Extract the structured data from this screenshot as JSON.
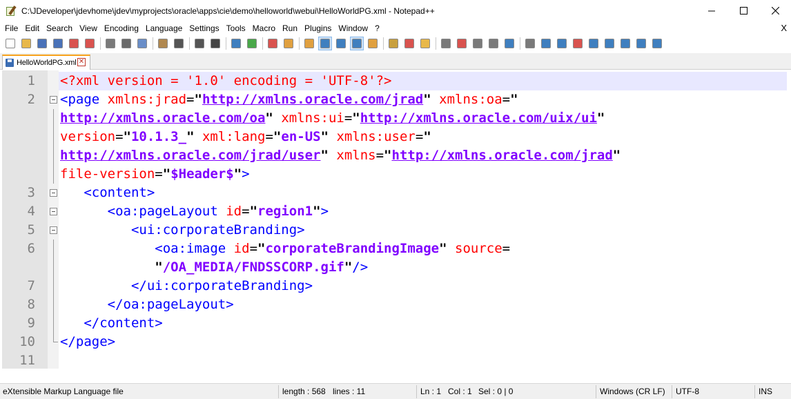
{
  "window": {
    "title": "C:\\JDeveloper\\jdevhome\\jdev\\myprojects\\oracle\\apps\\cie\\demo\\helloworld\\webui\\HelloWorldPG.xml - Notepad++",
    "minimize_icon": "minimize-icon",
    "maximize_icon": "maximize-icon",
    "close_icon": "close-icon"
  },
  "menu": {
    "items": [
      "File",
      "Edit",
      "Search",
      "View",
      "Encoding",
      "Language",
      "Settings",
      "Tools",
      "Macro",
      "Run",
      "Plugins",
      "Window",
      "?"
    ],
    "close": "X"
  },
  "toolbar": {
    "icons": [
      {
        "name": "new-file-icon",
        "color": "#ffffff"
      },
      {
        "name": "open-file-icon",
        "color": "#e8b84a"
      },
      {
        "name": "save-icon",
        "color": "#4a72b8"
      },
      {
        "name": "save-all-icon",
        "color": "#4a72b8"
      },
      {
        "name": "close-file-icon",
        "color": "#d9534f"
      },
      {
        "name": "close-all-icon",
        "color": "#d9534f"
      },
      {
        "name": "print-icon",
        "color": "#7a7a7a"
      },
      {
        "name": "cut-icon",
        "color": "#6a6a6a"
      },
      {
        "name": "copy-icon",
        "color": "#6a8ec8"
      },
      {
        "name": "paste-icon",
        "color": "#b08850"
      },
      {
        "name": "undo-icon",
        "color": "#555555"
      },
      {
        "name": "redo-icon",
        "color": "#555555"
      },
      {
        "name": "find-icon",
        "color": "#444444"
      },
      {
        "name": "replace-icon",
        "color": "#3f7fbf"
      },
      {
        "name": "zoom-in-icon",
        "color": "#4aa84a"
      },
      {
        "name": "zoom-out-icon",
        "color": "#d9534f"
      },
      {
        "name": "sync-vertical-icon",
        "color": "#e0a040"
      },
      {
        "name": "sync-horizontal-icon",
        "color": "#e0a040"
      },
      {
        "name": "word-wrap-icon",
        "color": "#3f7fbf"
      },
      {
        "name": "show-all-chars-icon",
        "color": "#3f7fbf"
      },
      {
        "name": "indent-guide-icon",
        "color": "#3f7fbf"
      },
      {
        "name": "user-language-icon",
        "color": "#e0a040"
      },
      {
        "name": "document-map-icon",
        "color": "#c8a040"
      },
      {
        "name": "function-list-icon",
        "color": "#d9534f"
      },
      {
        "name": "folder-as-workspace-icon",
        "color": "#e8b84a"
      },
      {
        "name": "monitoring-icon",
        "color": "#7a7a7a"
      },
      {
        "name": "record-macro-icon",
        "color": "#d9534f"
      },
      {
        "name": "stop-macro-icon",
        "color": "#7a7a7a"
      },
      {
        "name": "play-macro-icon",
        "color": "#7a7a7a"
      },
      {
        "name": "run-macro-multiple-icon",
        "color": "#3f7fbf"
      },
      {
        "name": "save-macro-icon",
        "color": "#7a7a7a"
      },
      {
        "name": "bookmark-icon",
        "color": "#3f7fbf"
      },
      {
        "name": "bookmark-next-icon",
        "color": "#3f7fbf"
      },
      {
        "name": "bookmark-prev-icon",
        "color": "#d9534f"
      },
      {
        "name": "collapse-icon",
        "color": "#3f7fbf"
      },
      {
        "name": "up-icon",
        "color": "#3f7fbf"
      },
      {
        "name": "down-icon",
        "color": "#3f7fbf"
      },
      {
        "name": "expand-icon",
        "color": "#3f7fbf"
      },
      {
        "name": "panel-icon",
        "color": "#3f7fbf"
      }
    ]
  },
  "tab": {
    "label": "HelloWorldPG.xml",
    "icon": "save-status-icon",
    "close_icon": "tab-close-icon",
    "accent": "#f7a21b"
  },
  "editor": {
    "line_numbers": [
      "1",
      "2",
      "",
      "",
      "",
      "",
      "3",
      "4",
      "5",
      "6",
      "",
      "7",
      "8",
      "9",
      "10",
      "11"
    ],
    "current_line": 1,
    "colors": {
      "xml_decl": "#ff0000",
      "tag": "#0000ff",
      "attribute": "#ff0000",
      "value": "#8000ff",
      "line_highlight": "#e8e8ff",
      "gutter": "#e4e4e4"
    },
    "lines": [
      {
        "tokens": [
          {
            "t": "xd",
            "s": "<?xml version = "
          },
          {
            "t": "xd",
            "s": "'1.0'"
          },
          {
            "t": "xd",
            "s": " encoding = "
          },
          {
            "t": "xd",
            "s": "'UTF-8'"
          },
          {
            "t": "xd",
            "s": "?>"
          }
        ]
      },
      {
        "tokens": [
          {
            "t": "tg",
            "s": "<page "
          },
          {
            "t": "at",
            "s": "xmlns:jrad"
          },
          {
            "t": "eq",
            "s": "="
          },
          {
            "t": "q",
            "s": "\""
          },
          {
            "t": "vu",
            "s": "http://xmlns.oracle.com/jrad"
          },
          {
            "t": "q",
            "s": "\""
          },
          {
            "t": "at",
            "s": " xmlns:oa"
          },
          {
            "t": "eq",
            "s": "="
          },
          {
            "t": "q",
            "s": "\""
          }
        ]
      },
      {
        "tokens": [
          {
            "t": "vu",
            "s": "http://xmlns.oracle.com/oa"
          },
          {
            "t": "q",
            "s": "\""
          },
          {
            "t": "at",
            "s": " xmlns:ui"
          },
          {
            "t": "eq",
            "s": "="
          },
          {
            "t": "q",
            "s": "\""
          },
          {
            "t": "vu",
            "s": "http://xmlns.oracle.com/uix/ui"
          },
          {
            "t": "q",
            "s": "\""
          }
        ]
      },
      {
        "tokens": [
          {
            "t": "at",
            "s": "version"
          },
          {
            "t": "eq",
            "s": "="
          },
          {
            "t": "q",
            "s": "\""
          },
          {
            "t": "v",
            "s": "10.1.3_"
          },
          {
            "t": "q",
            "s": "\""
          },
          {
            "t": "at",
            "s": " xml:lang"
          },
          {
            "t": "eq",
            "s": "="
          },
          {
            "t": "q",
            "s": "\""
          },
          {
            "t": "v",
            "s": "en-US"
          },
          {
            "t": "q",
            "s": "\""
          },
          {
            "t": "at",
            "s": " xmlns:user"
          },
          {
            "t": "eq",
            "s": "="
          },
          {
            "t": "q",
            "s": "\""
          }
        ]
      },
      {
        "tokens": [
          {
            "t": "vu",
            "s": "http://xmlns.oracle.com/jrad/user"
          },
          {
            "t": "q",
            "s": "\""
          },
          {
            "t": "at",
            "s": " xmlns"
          },
          {
            "t": "eq",
            "s": "="
          },
          {
            "t": "q",
            "s": "\""
          },
          {
            "t": "vu",
            "s": "http://xmlns.oracle.com/jrad"
          },
          {
            "t": "q",
            "s": "\""
          }
        ]
      },
      {
        "tokens": [
          {
            "t": "at",
            "s": "file-version"
          },
          {
            "t": "eq",
            "s": "="
          },
          {
            "t": "q",
            "s": "\""
          },
          {
            "t": "v",
            "s": "$Header$"
          },
          {
            "t": "q",
            "s": "\""
          },
          {
            "t": "tg",
            "s": ">"
          }
        ]
      },
      {
        "tokens": [
          {
            "t": "eq",
            "s": "   "
          },
          {
            "t": "tg",
            "s": "<content>"
          }
        ]
      },
      {
        "tokens": [
          {
            "t": "eq",
            "s": "      "
          },
          {
            "t": "tg",
            "s": "<oa:pageLayout "
          },
          {
            "t": "at",
            "s": "id"
          },
          {
            "t": "eq",
            "s": "="
          },
          {
            "t": "q",
            "s": "\""
          },
          {
            "t": "v",
            "s": "region1"
          },
          {
            "t": "q",
            "s": "\""
          },
          {
            "t": "tg",
            "s": ">"
          }
        ]
      },
      {
        "tokens": [
          {
            "t": "eq",
            "s": "         "
          },
          {
            "t": "tg",
            "s": "<ui:corporateBranding>"
          }
        ]
      },
      {
        "tokens": [
          {
            "t": "eq",
            "s": "            "
          },
          {
            "t": "tg",
            "s": "<oa:image "
          },
          {
            "t": "at",
            "s": "id"
          },
          {
            "t": "eq",
            "s": "="
          },
          {
            "t": "q",
            "s": "\""
          },
          {
            "t": "v",
            "s": "corporateBrandingImage"
          },
          {
            "t": "q",
            "s": "\""
          },
          {
            "t": "at",
            "s": " source"
          },
          {
            "t": "eq",
            "s": "="
          }
        ]
      },
      {
        "tokens": [
          {
            "t": "eq",
            "s": "            "
          },
          {
            "t": "q",
            "s": "\""
          },
          {
            "t": "v",
            "s": "/OA_MEDIA/FNDSSCORP.gif"
          },
          {
            "t": "q",
            "s": "\""
          },
          {
            "t": "tg",
            "s": "/>"
          }
        ]
      },
      {
        "tokens": [
          {
            "t": "eq",
            "s": "         "
          },
          {
            "t": "tg",
            "s": "</ui:corporateBranding>"
          }
        ]
      },
      {
        "tokens": [
          {
            "t": "eq",
            "s": "      "
          },
          {
            "t": "tg",
            "s": "</oa:pageLayout>"
          }
        ]
      },
      {
        "tokens": [
          {
            "t": "eq",
            "s": "   "
          },
          {
            "t": "tg",
            "s": "</content>"
          }
        ]
      },
      {
        "tokens": [
          {
            "t": "tg",
            "s": "</page>"
          }
        ]
      },
      {
        "tokens": []
      }
    ]
  },
  "status": {
    "file_type": "eXtensible Markup Language file",
    "length": "length : 568",
    "lines": "lines : 11",
    "ln": "Ln : 1",
    "col": "Col : 1",
    "sel": "Sel : 0 | 0",
    "eol": "Windows (CR LF)",
    "encoding": "UTF-8",
    "mode": "INS"
  }
}
